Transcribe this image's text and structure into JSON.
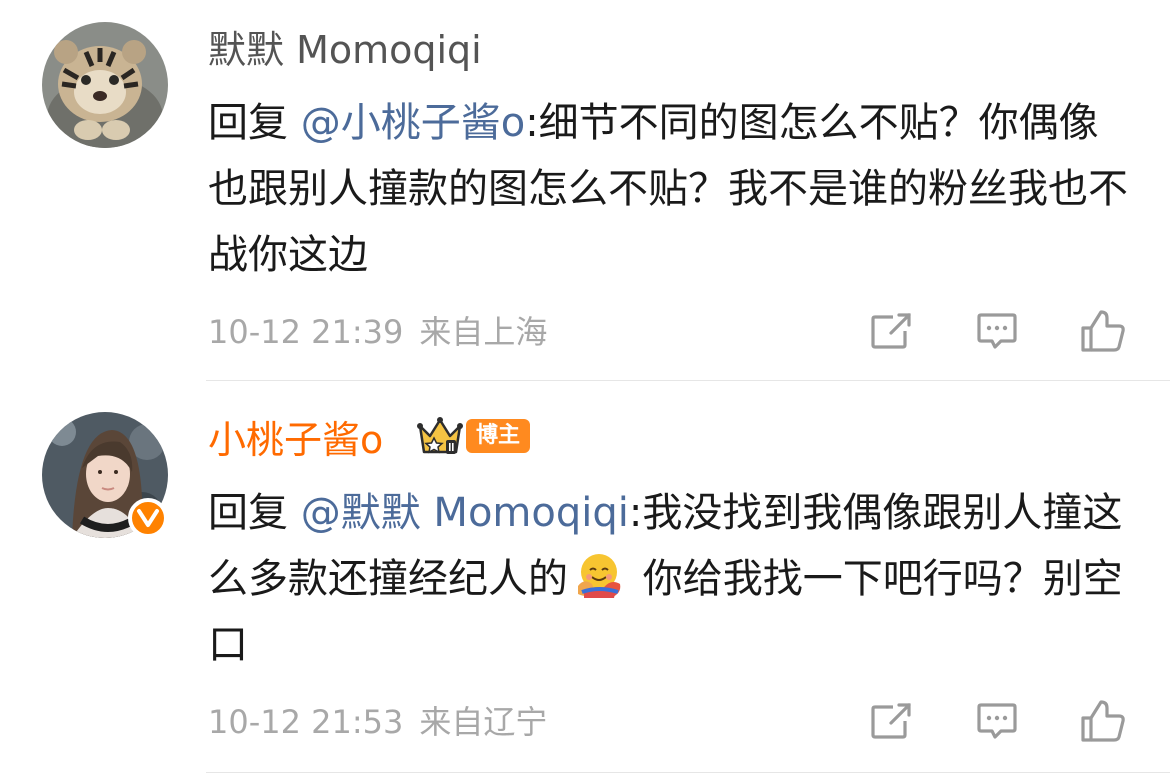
{
  "comments": [
    {
      "username": "默默 Momoqiqi",
      "reply_prefix": "回复 ",
      "mention": "@小桃子酱o",
      "text": ":细节不同的图怎么不贴？你偶像也跟别人撞款的图怎么不贴？我不是谁的粉丝我也不战你这边",
      "date": "10-12 21:39",
      "location": "来自上海",
      "avatar_icon": "tiger-cub-avatar"
    },
    {
      "username": "小桃子酱o",
      "badge_label": "博主",
      "reply_prefix": "回复 ",
      "mention": "@默默 Momoqiqi",
      "text_before_emoji": ":我没找到我偶像跟别人撞这么多款还撞经纪人的",
      "emoji": "hugging-face-emoji",
      "text_after_emoji": " 你给我找一下吧行吗？别空口",
      "date": "10-12 21:53",
      "location": "来自辽宁",
      "avatar_icon": "woman-photo-avatar",
      "verified_icon": "verified-v-icon"
    }
  ],
  "colors": {
    "mention": "#4c6b9a",
    "vip_username": "#ff6a00",
    "meta": "#a8a8a8",
    "badge": "#ff8a1f"
  }
}
